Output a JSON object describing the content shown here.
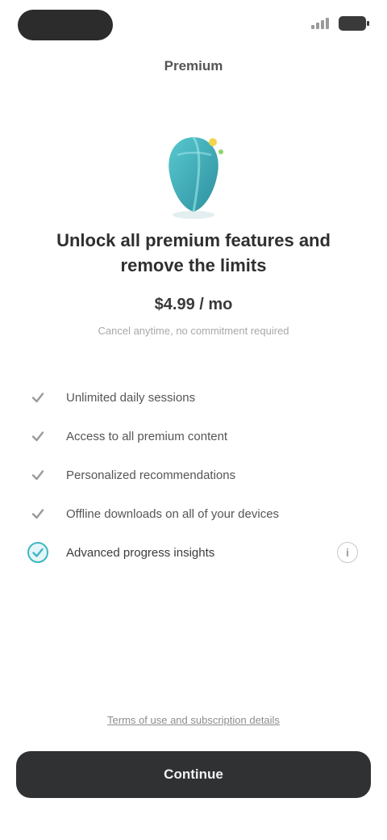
{
  "status_bar": {
    "time": "",
    "signal_icon": "signal-icon",
    "battery_icon": "battery-icon"
  },
  "header": {
    "title": "Premium"
  },
  "hero": {
    "illustration_icon": "gem-illustration",
    "headline": "Unlock all premium features and remove the limits",
    "price": "$4.99 / mo",
    "price_note": "Cancel anytime, no commitment required"
  },
  "features": [
    {
      "label": "Unlimited daily sessions",
      "icon": "check-icon",
      "highlight": false
    },
    {
      "label": "Access to all premium content",
      "icon": "check-icon",
      "highlight": false
    },
    {
      "label": "Personalized recommendations",
      "icon": "check-icon",
      "highlight": false
    },
    {
      "label": "Offline downloads on all of your devices",
      "icon": "check-icon",
      "highlight": false
    },
    {
      "label": "Advanced progress insights",
      "icon": "check-circle-icon",
      "highlight": true,
      "info_icon": "info-icon",
      "info_glyph": "i"
    }
  ],
  "footer": {
    "terms_link": "Terms of use and subscription details",
    "cta_label": "Continue"
  },
  "colors": {
    "accent": "#3fb6c4",
    "button_bg": "#2f3133",
    "text_primary": "#2f2f2f",
    "text_muted": "#a8a8a8"
  }
}
